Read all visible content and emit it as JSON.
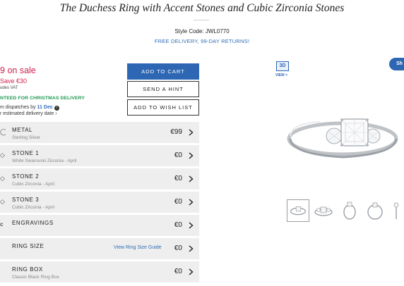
{
  "product": {
    "title": "The Duchess Ring with Accent Stones and Cubic Zirconia Stones",
    "style_code": "Style Code: JWL0770",
    "delivery_note": "FREE DELIVERY, 99-DAY RETURNS!"
  },
  "pricing": {
    "price_fragment": "9",
    "on_sale_label": "on sale",
    "save_text": "Save €30",
    "vat_text": "udes VAT",
    "christmas_text": "NTEED FOR CHRISTMAS DELIVERY",
    "dispatch_prefix": "m dispatches by",
    "dispatch_date": "11 Dec",
    "dispatch_info_icon": "i",
    "estimate_text": "r estimated delivery date"
  },
  "actions": {
    "add_to_cart": "ADD TO CART",
    "send_hint": "SEND A HINT",
    "add_to_wishlist": "ADD TO WISH LIST"
  },
  "options": [
    {
      "label": "METAL",
      "sub": "Sterling Silver",
      "price": "€99",
      "icon": "ring-metal-icon"
    },
    {
      "label": "STONE 1",
      "sub": "White Swarovski Zirconia - April",
      "price": "€0",
      "icon": "stone-icon"
    },
    {
      "label": "STONE 2",
      "sub": "Cubic Zirconia - April",
      "price": "€0",
      "icon": "stone-icon"
    },
    {
      "label": "STONE 3",
      "sub": "Cubic Zirconia - April",
      "price": "€0",
      "icon": "stone-icon"
    },
    {
      "label": "ENGRAVINGS",
      "sub": "",
      "price": "€0",
      "icon": "engraving-icon"
    },
    {
      "label": "RING SIZE",
      "sub": "",
      "price": "€0",
      "link": "View Ring Size Guide",
      "icon": "ring-size-icon"
    },
    {
      "label": "RING BOX",
      "sub": "Classic Black Ring Box",
      "price": "€0",
      "icon": "ring-box-icon"
    }
  ],
  "viewer": {
    "three_d_label": "3D",
    "view_label": "VIEW >",
    "share_label": "Sh",
    "thumbnails": [
      "angled-view",
      "front-view",
      "side-view",
      "top-view",
      "profile-view"
    ]
  },
  "colors": {
    "accent_blue": "#2d67b4",
    "sale_red": "#d0224e",
    "christmas_green": "#1f9a54",
    "row_grey": "#eeeeee"
  }
}
